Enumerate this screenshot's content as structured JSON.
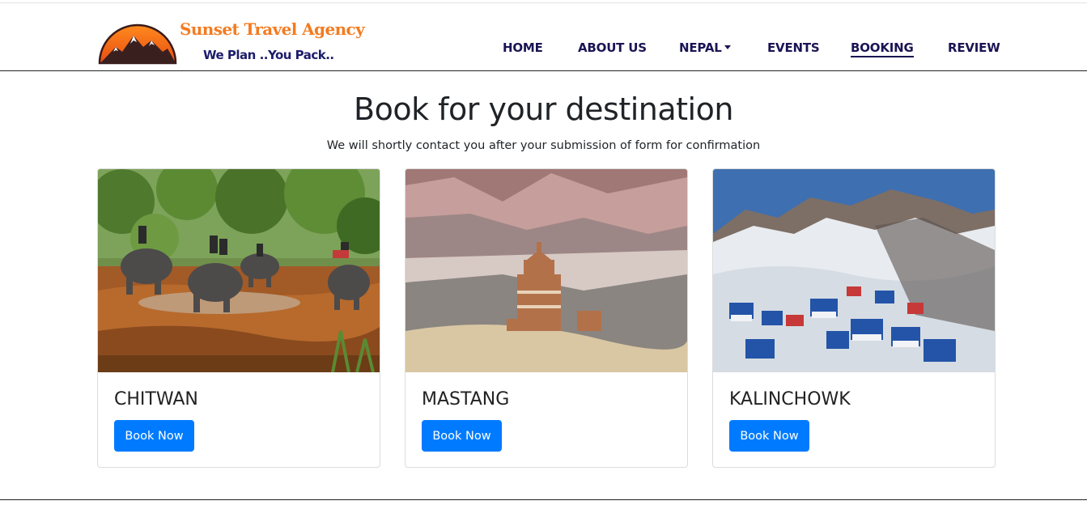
{
  "brand": {
    "name": "Sunset Travel Agency",
    "tagline": "We Plan ..You Pack..",
    "logo_icon": "sunset-mountain-logo"
  },
  "nav": {
    "items": [
      {
        "label": "HOME"
      },
      {
        "label": "ABOUT US"
      },
      {
        "label": "NEPAL",
        "has_dropdown": true
      },
      {
        "label": "EVENTS"
      },
      {
        "label": "BOOKING",
        "active": true
      },
      {
        "label": "REVIEW"
      }
    ]
  },
  "main": {
    "heading": "Book for your destination",
    "subheading": "We will shortly contact you after your submission of form for confirmation"
  },
  "cards": [
    {
      "title": "CHITWAN",
      "button": "Book Now",
      "image": "elephants-river-photo"
    },
    {
      "title": "MASTANG",
      "button": "Book Now",
      "image": "mustang-stupa-photo"
    },
    {
      "title": "KALINCHOWK",
      "button": "Book Now",
      "image": "snowy-village-photo"
    }
  ],
  "colors": {
    "brand_orange": "#f47b20",
    "nav_text": "#1a1454",
    "button_blue": "#007bff"
  }
}
